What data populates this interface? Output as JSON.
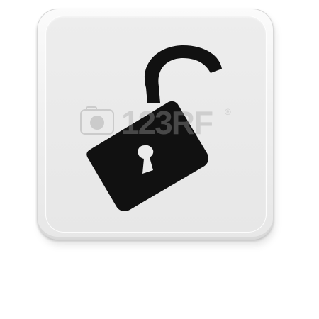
{
  "icon_button": {
    "icon": "unlocked-padlock-icon",
    "style": "rounded-square-app-button"
  },
  "watermark": {
    "text": "123RF",
    "registered_mark": "®"
  },
  "colors": {
    "background": "#ffffff",
    "button_face": "#ebebeb",
    "button_edge": "#d7d7d7",
    "icon": "#111111",
    "keyhole": "#ebebeb",
    "watermark": "#a2a2a2"
  }
}
